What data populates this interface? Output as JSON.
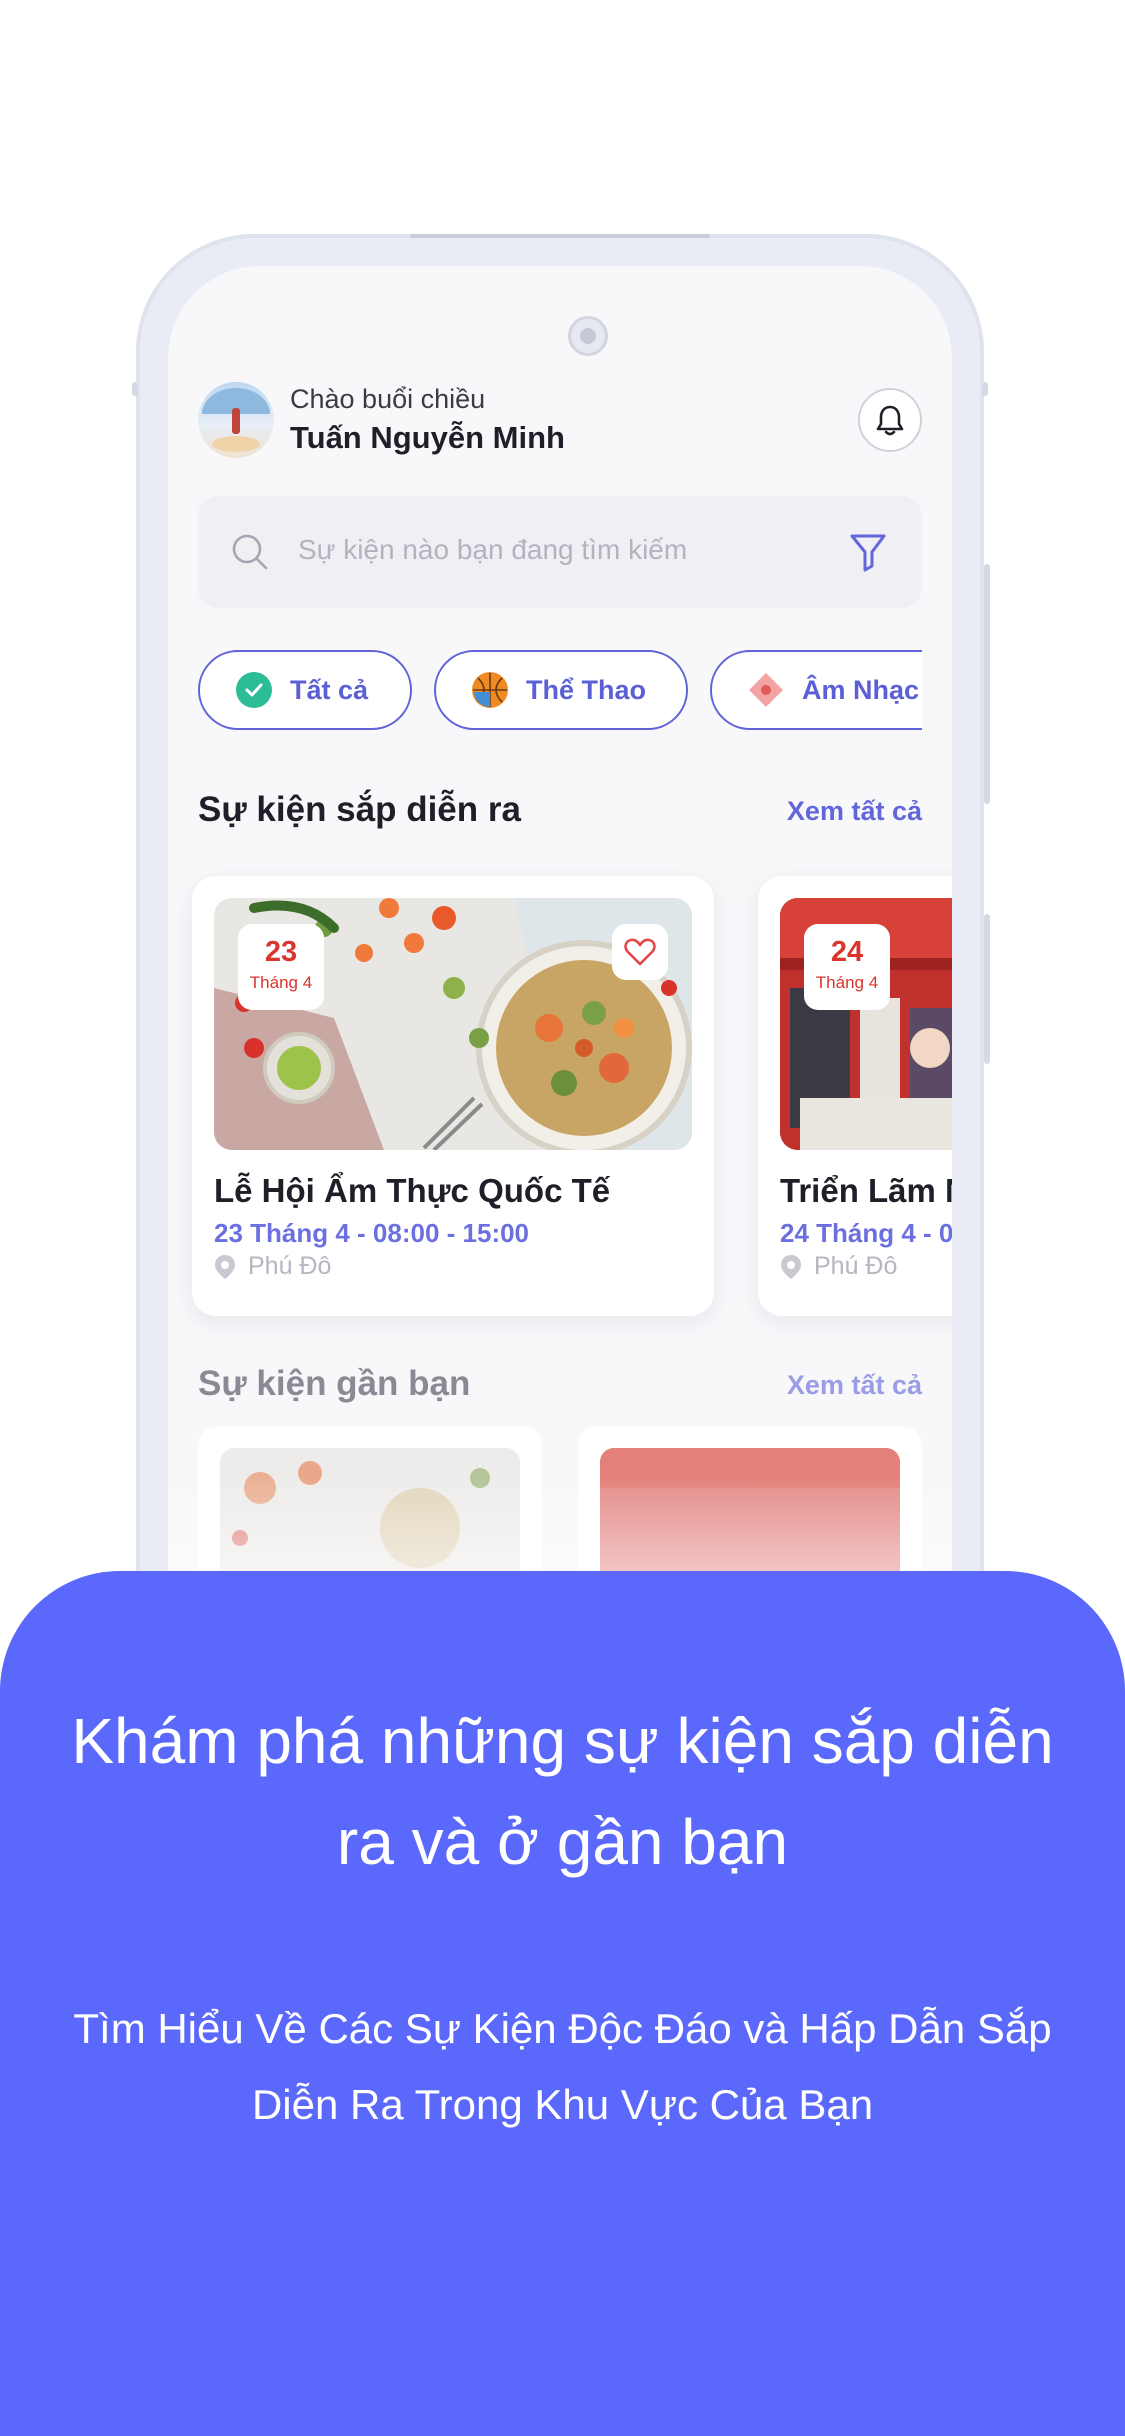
{
  "header": {
    "greeting": "Chào buổi chiều",
    "user_name": "Tuấn Nguyễn Minh"
  },
  "search": {
    "placeholder": "Sự kiện nào bạn đang tìm kiếm"
  },
  "categories": [
    {
      "label": "Tất cả",
      "icon": "check-circle-icon",
      "selected": true
    },
    {
      "label": "Thể Thao",
      "icon": "basketball-icon"
    },
    {
      "label": "Âm Nhạc",
      "icon": "music-icon"
    }
  ],
  "upcoming": {
    "title": "Sự kiện sắp diễn ra",
    "see_all": "Xem tất cả",
    "events": [
      {
        "day": "23",
        "month": "Tháng 4",
        "title": "Lễ Hội Ẩm Thực Quốc Tế",
        "time": "23 Tháng 4 - 08:00 - 15:00",
        "location": "Phú Đô"
      },
      {
        "day": "24",
        "month": "Tháng 4",
        "title": "Triển Lãm N",
        "time": "24 Tháng 4 - 0",
        "location": "Phú Đô"
      }
    ]
  },
  "nearby": {
    "title": "Sự kiện gần bạn",
    "see_all": "Xem tất cả"
  },
  "promo": {
    "title": "Khám phá những sự kiện sắp diễn ra và ở gần bạn",
    "description": "Tìm Hiểu Về Các Sự Kiện Độc Đáo và Hấp Dẫn Sắp Diễn Ra Trong Khu Vực Của Bạn"
  },
  "colors": {
    "accent": "#6366d9",
    "panel": "#5a69fb",
    "date": "#d8352c",
    "selected_chip_icon": "#2dbd96"
  }
}
